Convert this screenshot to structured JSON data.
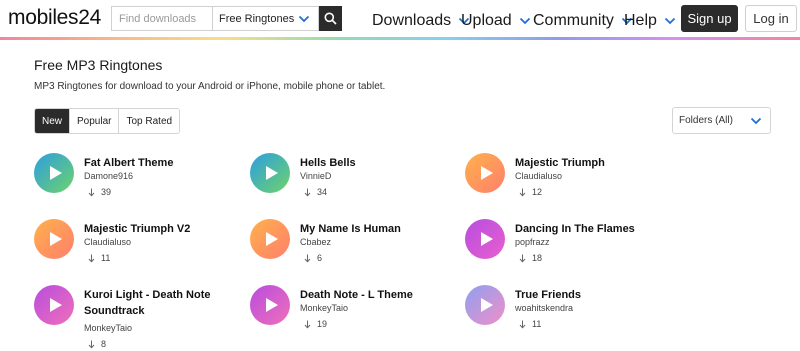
{
  "header": {
    "logo": "mobiles24",
    "search_placeholder": "Find downloads",
    "search_category": "Free Ringtones",
    "nav": [
      {
        "label": "Downloads"
      },
      {
        "label": "Upload"
      },
      {
        "label": "Community"
      },
      {
        "label": "Help"
      }
    ],
    "signup_label": "Sign up",
    "login_label": "Log in",
    "accent_color": "#1e6fd9"
  },
  "main": {
    "title": "Free MP3 Ringtones",
    "subtitle": "MP3 Ringtones for download to your Android or iPhone, mobile phone or tablet.",
    "tabs": [
      {
        "label": "New",
        "active": true
      },
      {
        "label": "Popular",
        "active": false
      },
      {
        "label": "Top Rated",
        "active": false
      }
    ],
    "folder_filter": "Folders (All)",
    "ringtones": [
      {
        "title": "Fat Albert Theme",
        "author": "Damone916",
        "downloads": "39",
        "gradient": [
          "#2d9ee0",
          "#6ed36a"
        ]
      },
      {
        "title": "Hells Bells",
        "author": "VinnieD",
        "downloads": "34",
        "gradient": [
          "#2d9ee0",
          "#6ed36a"
        ]
      },
      {
        "title": "Majestic Triumph",
        "author": "Claudialuso",
        "downloads": "12",
        "gradient": [
          "#ffb14a",
          "#ff7f6e"
        ]
      },
      {
        "title": "Majestic Triumph V2",
        "author": "Claudialuso",
        "downloads": "11",
        "gradient": [
          "#ffb14a",
          "#ff7f6e"
        ]
      },
      {
        "title": "My Name Is Human",
        "author": "Cbabez",
        "downloads": "6",
        "gradient": [
          "#ffb14a",
          "#ff7f6e"
        ]
      },
      {
        "title": "Dancing In The Flames",
        "author": "popfrazz",
        "downloads": "18",
        "gradient": [
          "#b84de0",
          "#e85fcf"
        ]
      },
      {
        "title": "Kuroi Light - Death Note Soundtrack",
        "author": "MonkeyTaio",
        "downloads": "8",
        "gradient": [
          "#b84de0",
          "#f06fb8"
        ]
      },
      {
        "title": "Death Note - L Theme",
        "author": "MonkeyTaio",
        "downloads": "19",
        "gradient": [
          "#b84de0",
          "#f06fb8"
        ]
      },
      {
        "title": "True Friends",
        "author": "woahitskendra",
        "downloads": "11",
        "gradient": [
          "#8fa0f0",
          "#f08fc8"
        ]
      }
    ]
  }
}
